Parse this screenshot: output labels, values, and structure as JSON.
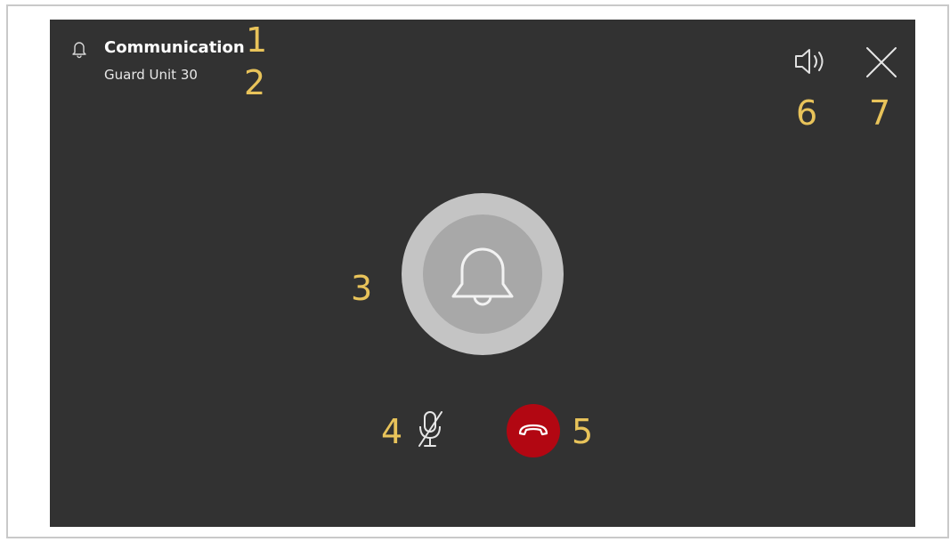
{
  "header": {
    "title": "Communication",
    "subtitle": "Guard Unit 30",
    "icon": "bell-icon"
  },
  "controls": {
    "speaker_icon": "speaker-icon",
    "close_icon": "close-icon",
    "call_icon": "bell-icon",
    "mute_icon": "microphone-muted-icon",
    "hangup_icon": "hang-up-icon"
  },
  "callouts": {
    "c1": "1",
    "c2": "2",
    "c3": "3",
    "c4": "4",
    "c5": "5",
    "c6": "6",
    "c7": "7"
  },
  "colors": {
    "screen_background": "#323232",
    "callout": "#e8c35a",
    "hangup": "#b20712",
    "call_ring_outer": "#c4c4c4",
    "call_ring_inner": "#a8a8a8"
  }
}
